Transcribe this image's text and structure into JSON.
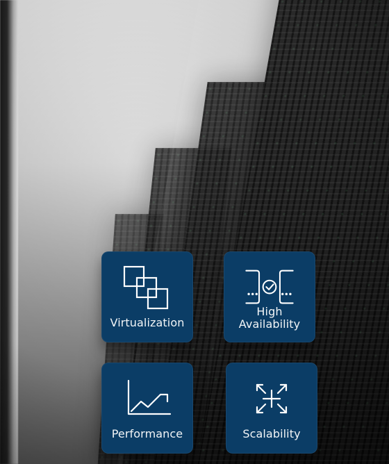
{
  "tiles": [
    {
      "label": "Virtualization",
      "icon": "virtualization-icon"
    },
    {
      "label_line1": "High",
      "label_line2": "Availability",
      "icon": "high-availability-icon"
    },
    {
      "label": "Performance",
      "icon": "performance-chart-icon"
    },
    {
      "label": "Scalability",
      "icon": "scalability-icon"
    }
  ],
  "colors": {
    "tile_bg": "#0b3d66",
    "tile_text": "#ffffff"
  }
}
